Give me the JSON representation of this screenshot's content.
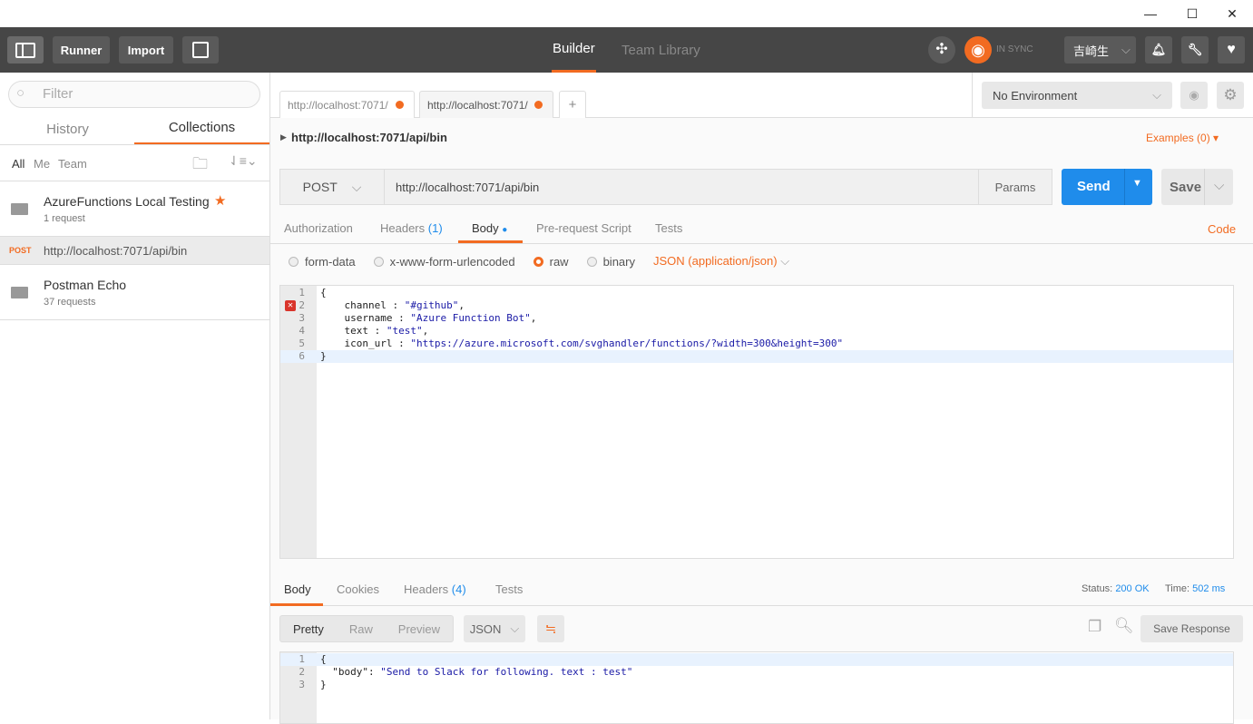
{
  "window": {
    "minimize": "—",
    "maximize": "☐",
    "close": "✕"
  },
  "header": {
    "runner": "Runner",
    "import": "Import",
    "tabs": [
      "Builder",
      "Team Library"
    ],
    "sync_status": "IN SYNC",
    "user": "吉崎生"
  },
  "sidebar": {
    "filter_placeholder": "Filter",
    "tabs": [
      "History",
      "Collections"
    ],
    "filters": [
      "All",
      "Me",
      "Team"
    ],
    "collections": [
      {
        "name": "AzureFunctions Local Testing",
        "count": "1 request",
        "starred": true,
        "requests": [
          {
            "method": "POST",
            "url": "http://localhost:7071/api/bin"
          }
        ]
      },
      {
        "name": "Postman Echo",
        "count": "37 requests"
      }
    ]
  },
  "request_tabs": [
    {
      "label": "http://localhost:7071/"
    },
    {
      "label": "http://localhost:7071/"
    }
  ],
  "environment": {
    "selected": "No Environment"
  },
  "request": {
    "title": "http://localhost:7071/api/bin",
    "examples": "Examples (0)",
    "method": "POST",
    "url": "http://localhost:7071/api/bin",
    "params": "Params",
    "send": "Send",
    "save": "Save",
    "tabs": [
      "Authorization",
      "Headers",
      "Body",
      "Pre-request Script",
      "Tests"
    ],
    "headers_count": "(1)",
    "code": "Code",
    "body_modes": [
      "form-data",
      "x-www-form-urlencoded",
      "raw",
      "binary"
    ],
    "selected_mode": "raw",
    "content_type": "JSON (application/json)",
    "body_lines": [
      {
        "n": "1",
        "text": "{",
        "str": "",
        "tail": ""
      },
      {
        "n": "2",
        "text": "    channel : ",
        "str": "\"#github\"",
        "tail": ",",
        "error": true
      },
      {
        "n": "3",
        "text": "    username : ",
        "str": "\"Azure Function Bot\"",
        "tail": ","
      },
      {
        "n": "4",
        "text": "    text : ",
        "str": "\"test\"",
        "tail": ","
      },
      {
        "n": "5",
        "text": "    icon_url : ",
        "str": "\"https://azure.microsoft.com/svghandler/functions/?width=300&height=300\"",
        "tail": ""
      },
      {
        "n": "6",
        "text": "}",
        "str": "",
        "tail": ""
      }
    ]
  },
  "response": {
    "tabs": [
      "Body",
      "Cookies",
      "Headers",
      "Tests"
    ],
    "headers_count": "(4)",
    "status_label": "Status:",
    "status": "200 OK",
    "time_label": "Time:",
    "time": "502 ms",
    "views": [
      "Pretty",
      "Raw",
      "Preview"
    ],
    "format": "JSON",
    "save_response": "Save Response",
    "body_lines": [
      {
        "n": "1",
        "text": "{",
        "str": "",
        "tail": ""
      },
      {
        "n": "2",
        "text": "  \"body\": ",
        "str": "\"Send to Slack for following. text : test\"",
        "tail": ""
      },
      {
        "n": "3",
        "text": "}",
        "str": "",
        "tail": ""
      }
    ]
  },
  "colors": {
    "accent": "#f26b21",
    "send": "#1f8ceb",
    "header_bg": "#464646"
  }
}
